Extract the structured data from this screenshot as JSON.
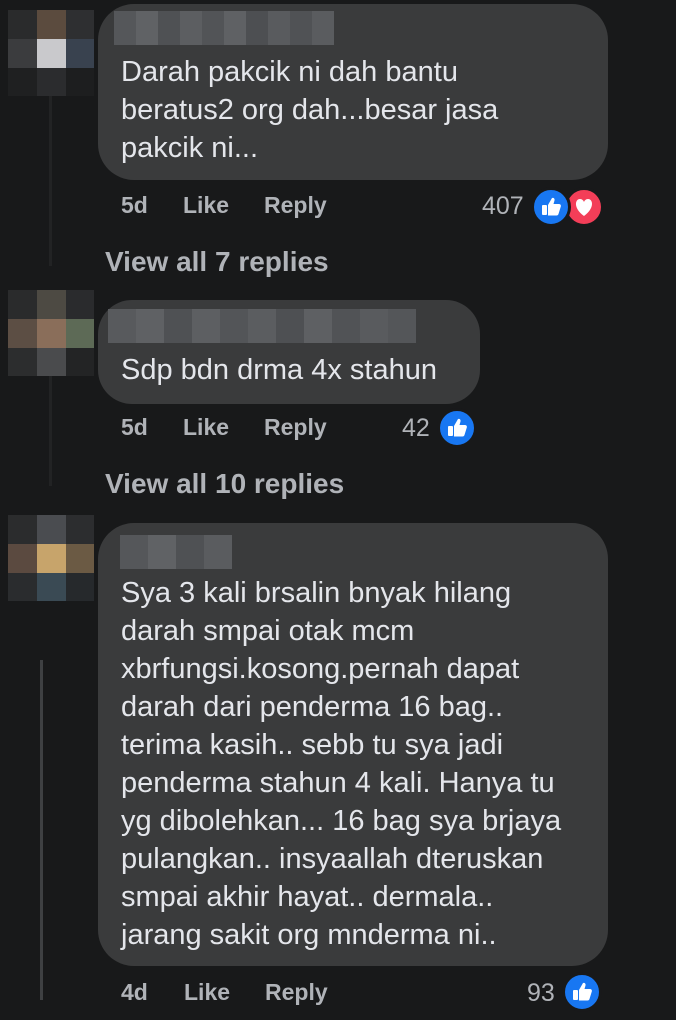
{
  "comments": [
    {
      "text": "Darah pakcik ni dah bantu\nberatus2 org dah...besar jasa\npakcik ni...",
      "time": "5d",
      "like_label": "Like",
      "reply_label": "Reply",
      "reaction_count": "407",
      "reactions": [
        "like-icon",
        "love-icon"
      ],
      "view_replies": "View all 7 replies"
    },
    {
      "text": "Sdp bdn drma 4x stahun",
      "time": "5d",
      "like_label": "Like",
      "reply_label": "Reply",
      "reaction_count": "42",
      "reactions": [
        "like-icon"
      ],
      "view_replies": "View all 10 replies"
    },
    {
      "text": "Sya 3 kali brsalin bnyak hilang\ndarah smpai otak mcm\nxbrfungsi.kosong.pernah dapat\ndarah dari penderma 16 bag..\nterima kasih.. sebb tu sya jadi\npenderma stahun 4 kali. Hanya tu\nyg dibolehkan... 16 bag sya brjaya\npulangkan.. insyaallah dteruskan\nsmpai akhir hayat.. dermala..\njarang sakit org mnderma ni..",
      "time": "4d",
      "like_label": "Like",
      "reply_label": "Reply",
      "reaction_count": "93",
      "reactions": [
        "like-icon"
      ]
    }
  ],
  "colors": {
    "background": "#18191a",
    "bubble": "#3a3b3c",
    "text": "#e4e6eb",
    "meta": "#b0b3b8",
    "like_blue": "#1877f2",
    "love_red": "#f33e58"
  }
}
